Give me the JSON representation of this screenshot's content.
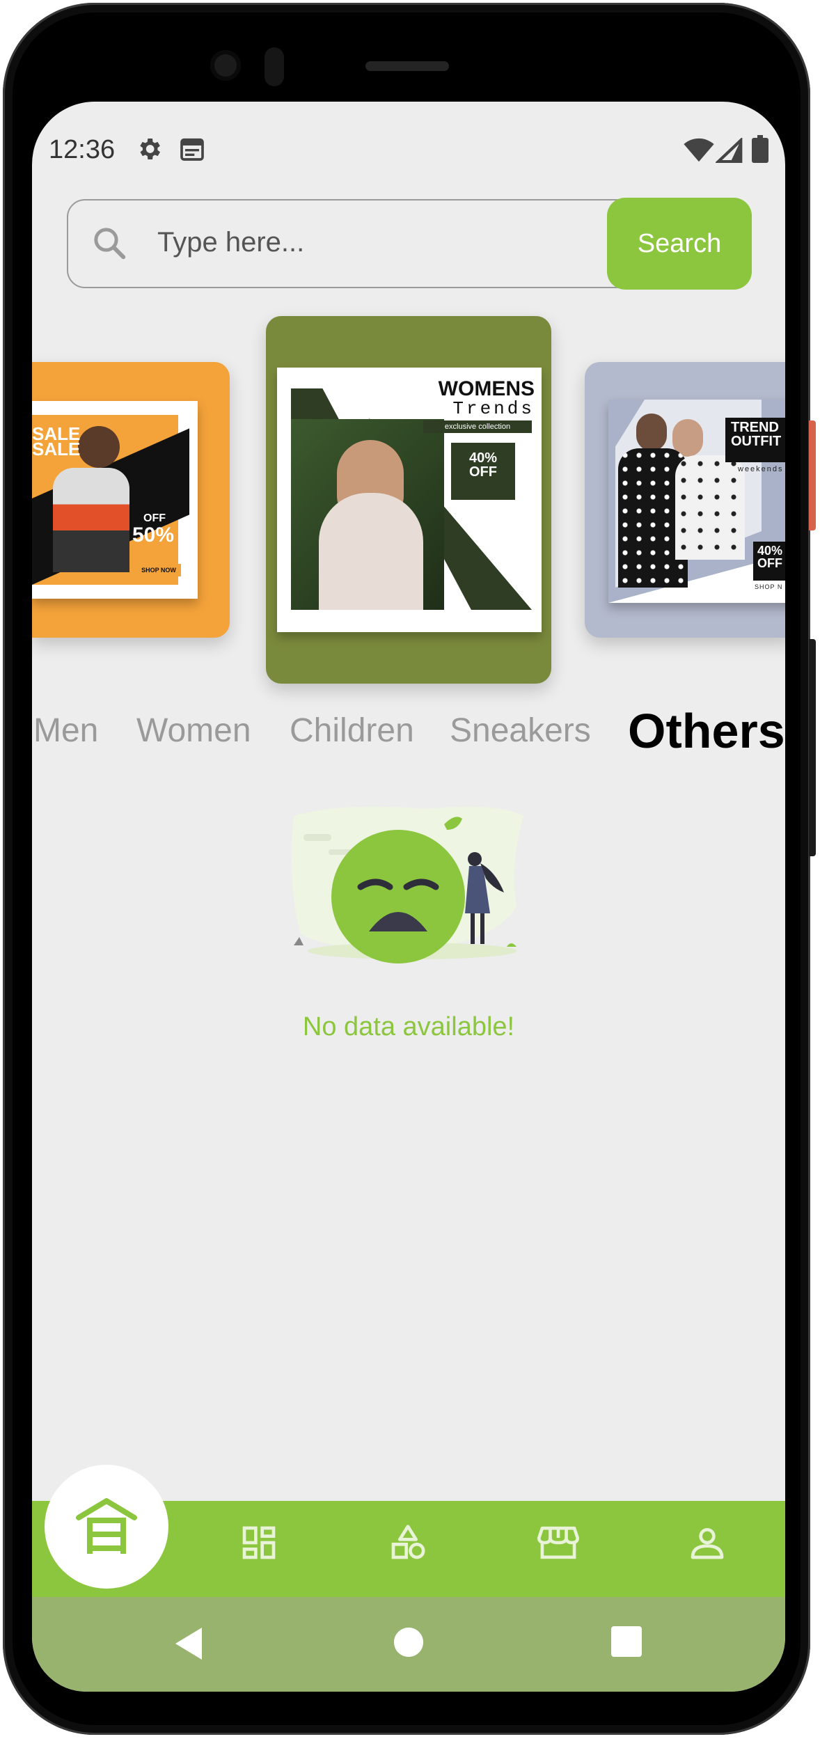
{
  "status_bar": {
    "time": "12:36",
    "left_icons": [
      "gear-icon",
      "calendar-icon"
    ],
    "right_icons": [
      "wifi-icon",
      "signal-icon",
      "battery-icon"
    ]
  },
  "search": {
    "placeholder": "Type here...",
    "value": "",
    "button_label": "Search"
  },
  "carousel": {
    "cards": [
      {
        "name": "card-men",
        "bg_color": "#f4a23a",
        "poster_text": [
          "SALE",
          "SALE",
          "OFF",
          "50%",
          "SHOP NOW"
        ]
      },
      {
        "name": "card-women",
        "bg_color": "#7a8a3c",
        "poster_text": [
          "WOMENS",
          "Trends",
          "exclusive collection",
          "40%",
          "OFF"
        ]
      },
      {
        "name": "card-others",
        "bg_color": "#b4bacd",
        "poster_text": [
          "TREND",
          "OUTFIT",
          "weekends",
          "40%",
          "OFF",
          "SHOP N"
        ]
      }
    ]
  },
  "categories": {
    "items": [
      "Men",
      "Women",
      "Children",
      "Sneakers",
      "Others"
    ],
    "selected": "Others"
  },
  "empty_state": {
    "message": "No data available!"
  },
  "bottom_nav": {
    "items": [
      "home-icon",
      "grid-icon",
      "shapes-icon",
      "store-icon",
      "profile-icon"
    ],
    "active": "home-icon"
  },
  "system_nav": [
    "back-icon",
    "home-circle-icon",
    "recents-icon"
  ],
  "colors": {
    "accent": "#8cc63f",
    "screen_bg": "#ededed",
    "system_nav_bg": "#97b36e"
  }
}
